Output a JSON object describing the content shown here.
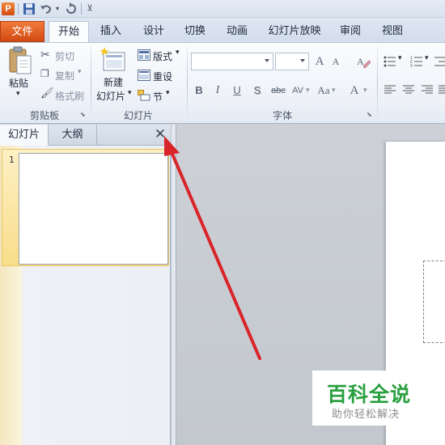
{
  "quick_access": {
    "app_icon_letter": "P",
    "icons": [
      "save-icon",
      "undo-icon",
      "redo-icon",
      "customize-icon"
    ]
  },
  "ribbon_tabs": [
    "文件",
    "开始",
    "插入",
    "设计",
    "切换",
    "动画",
    "幻灯片放映",
    "审阅",
    "视图"
  ],
  "active_tab": "开始",
  "clipboard": {
    "paste": "粘贴",
    "cut": "剪切",
    "copy": "复制",
    "format_painter": "格式刷",
    "group_label": "剪贴板"
  },
  "slides_group": {
    "new_slide_line1": "新建",
    "new_slide_line2": "幻灯片",
    "layout": "版式",
    "reset": "重设",
    "section": "节",
    "group_label": "幻灯片"
  },
  "font_group": {
    "font_name": "",
    "font_size": "",
    "grow": "A",
    "shrink": "A",
    "bold": "B",
    "italic": "I",
    "underline": "U",
    "shadow": "S",
    "strike": "abc",
    "spacing": "AV",
    "case": "Aa",
    "color": "A",
    "group_label": "字体"
  },
  "left_panel": {
    "tab_slides": "幻灯片",
    "tab_outline": "大纲",
    "close_symbol": "✕",
    "slide_number": "1"
  },
  "watermark": {
    "title": "百科全说",
    "subtitle": "助你轻松解决"
  },
  "colors": {
    "file_tab": "#d24a14",
    "arrow": "#d9242a",
    "watermark_green": "#2aa040"
  }
}
